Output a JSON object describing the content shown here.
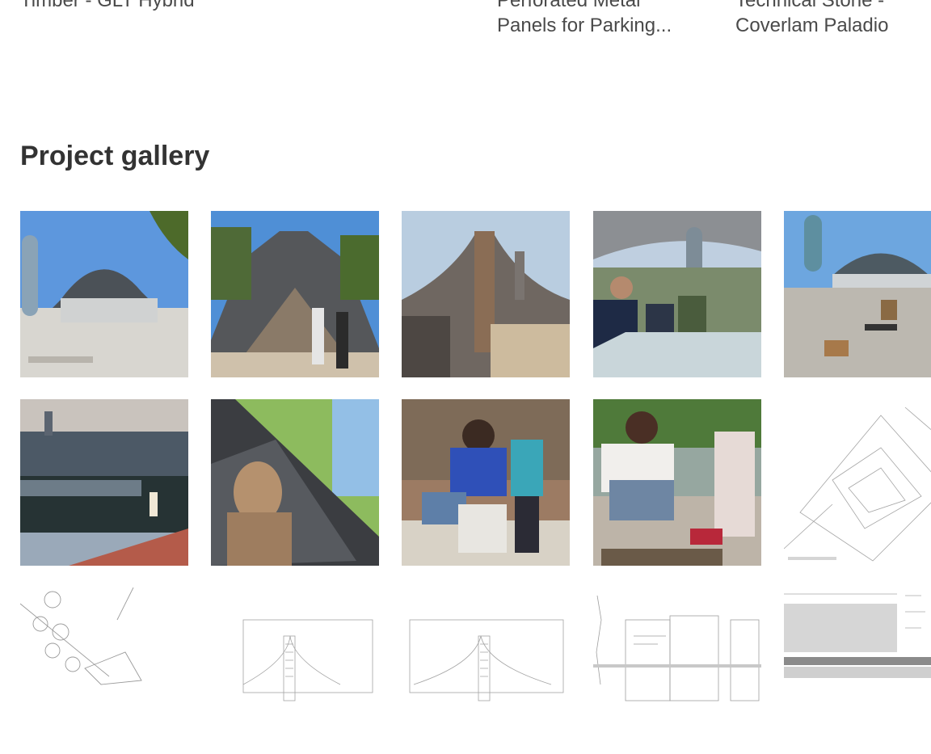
{
  "related_products": [
    {
      "label": "Timber - GLT Hybrid"
    },
    {
      "label": "Perforated Metal\nPanels for Parking..."
    },
    {
      "label": "Technical Stone -\nCoverlam Paladio"
    }
  ],
  "gallery": {
    "title": "Project gallery",
    "rows": [
      [
        "photo-tower-pavilion-plaza",
        "photo-pavilion-arch-visitors",
        "photo-pavilion-facade-sunset",
        "photo-visitors-at-table",
        "photo-plaza-seating"
      ],
      [
        "photo-city-dusk-aerial",
        "photo-sculpture-closeup",
        "photo-woman-child-stool",
        "photo-woman-child-crafting",
        "drawing-site-plan"
      ],
      [
        "drawing-landscape-plan",
        "drawing-elevation-1",
        "drawing-elevation-2",
        "drawing-section-details",
        "drawing-long-section"
      ]
    ]
  }
}
